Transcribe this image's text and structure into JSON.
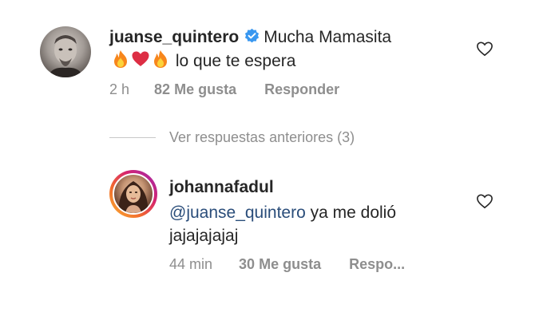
{
  "comment1": {
    "username": "juanse_quintero",
    "text_line1": "Mucha Mamasita",
    "text_line2": "lo que te espera",
    "time": "2 h",
    "likes": "82 Me gusta",
    "reply": "Responder",
    "verified_icon": "verified-badge-icon",
    "emoji_sequence": [
      "fire-emoji",
      "red-heart-emoji",
      "fire-emoji"
    ],
    "like_icon": "heart-outline-icon"
  },
  "view_previous": {
    "label": "Ver respuestas anteriores (3)"
  },
  "comment2": {
    "username": "johannafadul",
    "mention": "@juanse_quintero",
    "text_after_mention": " ya me dolió",
    "text_line2": "jajajajajaj",
    "time": "44 min",
    "likes": "30 Me gusta",
    "reply": "Respo...",
    "like_icon": "heart-outline-icon"
  },
  "colors": {
    "text": "#262626",
    "meta": "#8e8e8e",
    "mention": "#2a4d7a",
    "verified": "#3897f0",
    "divider": "#c7c7c7"
  }
}
